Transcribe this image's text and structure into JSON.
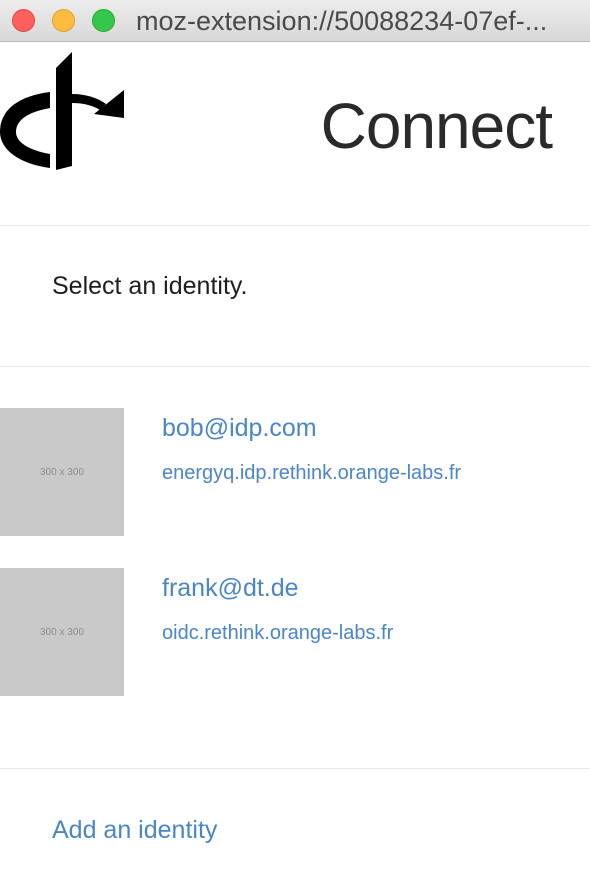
{
  "window": {
    "title": "moz-extension://50088234-07ef-..."
  },
  "header": {
    "logo_icon": "openid-logo-icon",
    "title": "Connect"
  },
  "instruction": "Select an identity.",
  "identities": [
    {
      "thumbnail_label": "300 x 300",
      "email": "bob@idp.com",
      "domain": "energyq.idp.rethink.orange-labs.fr"
    },
    {
      "thumbnail_label": "300 x 300",
      "email": "frank@dt.de",
      "domain": "oidc.rethink.orange-labs.fr"
    }
  ],
  "add_identity_label": "Add an identity",
  "colors": {
    "link": "#4a86c8",
    "thumbnail": "#c9c9c9",
    "close": "#fc605c",
    "minimize": "#fdbc40",
    "maximize": "#34c84a"
  }
}
